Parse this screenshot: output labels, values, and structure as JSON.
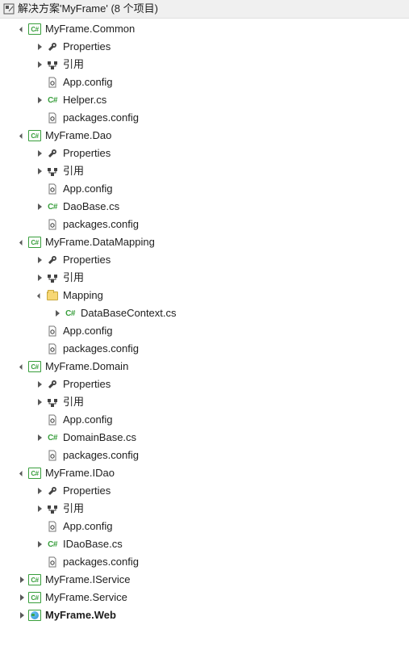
{
  "header": {
    "title": "解决方案'MyFrame' (8 个项目)"
  },
  "tree": [
    {
      "depth": 0,
      "exp": "open",
      "icon": "csproj",
      "label": "MyFrame.Common",
      "interact": true
    },
    {
      "depth": 1,
      "exp": "closed",
      "icon": "wrench",
      "label": "Properties",
      "interact": true
    },
    {
      "depth": 1,
      "exp": "closed",
      "icon": "refs",
      "label": "引用",
      "interact": true
    },
    {
      "depth": 1,
      "exp": "none",
      "icon": "config",
      "label": "App.config",
      "interact": true
    },
    {
      "depth": 1,
      "exp": "closed",
      "icon": "csfile",
      "label": "Helper.cs",
      "interact": true
    },
    {
      "depth": 1,
      "exp": "none",
      "icon": "config",
      "label": "packages.config",
      "interact": true
    },
    {
      "depth": 0,
      "exp": "open",
      "icon": "csproj",
      "label": "MyFrame.Dao",
      "interact": true
    },
    {
      "depth": 1,
      "exp": "closed",
      "icon": "wrench",
      "label": "Properties",
      "interact": true
    },
    {
      "depth": 1,
      "exp": "closed",
      "icon": "refs",
      "label": "引用",
      "interact": true
    },
    {
      "depth": 1,
      "exp": "none",
      "icon": "config",
      "label": "App.config",
      "interact": true
    },
    {
      "depth": 1,
      "exp": "closed",
      "icon": "csfile",
      "label": "DaoBase.cs",
      "interact": true
    },
    {
      "depth": 1,
      "exp": "none",
      "icon": "config",
      "label": "packages.config",
      "interact": true
    },
    {
      "depth": 0,
      "exp": "open",
      "icon": "csproj",
      "label": "MyFrame.DataMapping",
      "interact": true
    },
    {
      "depth": 1,
      "exp": "closed",
      "icon": "wrench",
      "label": "Properties",
      "interact": true
    },
    {
      "depth": 1,
      "exp": "closed",
      "icon": "refs",
      "label": "引用",
      "interact": true
    },
    {
      "depth": 1,
      "exp": "open",
      "icon": "folder",
      "label": "Mapping",
      "interact": true
    },
    {
      "depth": 2,
      "exp": "closed",
      "icon": "csfile",
      "label": "DataBaseContext.cs",
      "interact": true
    },
    {
      "depth": 1,
      "exp": "none",
      "icon": "config",
      "label": "App.config",
      "interact": true
    },
    {
      "depth": 1,
      "exp": "none",
      "icon": "config",
      "label": "packages.config",
      "interact": true
    },
    {
      "depth": 0,
      "exp": "open",
      "icon": "csproj",
      "label": "MyFrame.Domain",
      "interact": true
    },
    {
      "depth": 1,
      "exp": "closed",
      "icon": "wrench",
      "label": "Properties",
      "interact": true
    },
    {
      "depth": 1,
      "exp": "closed",
      "icon": "refs",
      "label": "引用",
      "interact": true
    },
    {
      "depth": 1,
      "exp": "none",
      "icon": "config",
      "label": "App.config",
      "interact": true
    },
    {
      "depth": 1,
      "exp": "closed",
      "icon": "csfile",
      "label": "DomainBase.cs",
      "interact": true
    },
    {
      "depth": 1,
      "exp": "none",
      "icon": "config",
      "label": "packages.config",
      "interact": true
    },
    {
      "depth": 0,
      "exp": "open",
      "icon": "csproj",
      "label": "MyFrame.IDao",
      "interact": true
    },
    {
      "depth": 1,
      "exp": "closed",
      "icon": "wrench",
      "label": "Properties",
      "interact": true
    },
    {
      "depth": 1,
      "exp": "closed",
      "icon": "refs",
      "label": "引用",
      "interact": true
    },
    {
      "depth": 1,
      "exp": "none",
      "icon": "config",
      "label": "App.config",
      "interact": true
    },
    {
      "depth": 1,
      "exp": "closed",
      "icon": "csfile",
      "label": "IDaoBase.cs",
      "interact": true
    },
    {
      "depth": 1,
      "exp": "none",
      "icon": "config",
      "label": "packages.config",
      "interact": true
    },
    {
      "depth": 0,
      "exp": "closed",
      "icon": "csproj",
      "label": "MyFrame.IService",
      "interact": true
    },
    {
      "depth": 0,
      "exp": "closed",
      "icon": "csproj",
      "label": "MyFrame.Service",
      "interact": true
    },
    {
      "depth": 0,
      "exp": "closed",
      "icon": "webproj",
      "label": "MyFrame.Web",
      "bold": true,
      "interact": true
    }
  ],
  "colors": {
    "csharp_green": "#389e3c",
    "triangle_gray": "#595959"
  }
}
